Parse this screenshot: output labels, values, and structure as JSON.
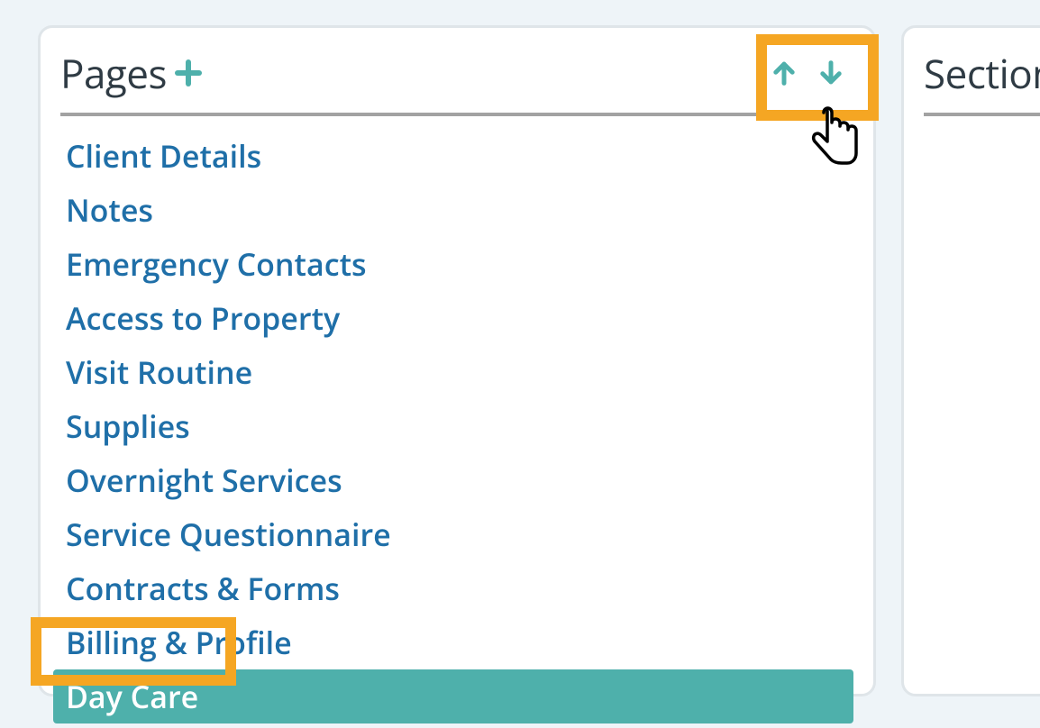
{
  "pages_panel": {
    "title": "Pages",
    "items": [
      {
        "label": "Client Details",
        "selected": false
      },
      {
        "label": "Notes",
        "selected": false
      },
      {
        "label": "Emergency Contacts",
        "selected": false
      },
      {
        "label": "Access to Property",
        "selected": false
      },
      {
        "label": "Visit Routine",
        "selected": false
      },
      {
        "label": "Supplies",
        "selected": false
      },
      {
        "label": "Overnight Services",
        "selected": false
      },
      {
        "label": "Service Questionnaire",
        "selected": false
      },
      {
        "label": "Contracts & Forms",
        "selected": false
      },
      {
        "label": "Billing & Profile",
        "selected": false
      },
      {
        "label": "Day Care",
        "selected": true
      }
    ]
  },
  "sections_panel": {
    "title": "Section"
  },
  "colors": {
    "link": "#1f6fa8",
    "teal": "#4eb0ab",
    "highlight": "#f5a623",
    "header_rule": "#a2a2a2",
    "panel_border": "#dfe5e9",
    "page_bg": "#eef4f8",
    "title_text": "#2f3b44"
  },
  "icons": {
    "plus": "plus-icon",
    "arrow_up": "arrow-up-icon",
    "arrow_down": "arrow-down-icon"
  }
}
